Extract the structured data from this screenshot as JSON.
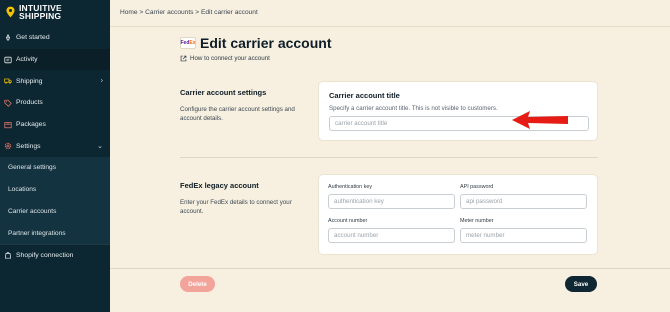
{
  "brand": {
    "line1": "INTUITIVE",
    "line2": "SHIPPING"
  },
  "sidebar": {
    "items": [
      {
        "label": "Get started",
        "icon": "rocket-icon"
      },
      {
        "label": "Activity",
        "icon": "activity-icon"
      },
      {
        "label": "Shipping",
        "icon": "truck-icon",
        "chevron": "›"
      },
      {
        "label": "Products",
        "icon": "tag-icon"
      },
      {
        "label": "Packages",
        "icon": "package-icon"
      },
      {
        "label": "Settings",
        "icon": "gear-icon",
        "chevron": "⌄"
      }
    ],
    "sub_items": [
      {
        "label": "General settings"
      },
      {
        "label": "Locations"
      },
      {
        "label": "Carrier accounts"
      },
      {
        "label": "Partner integrations"
      }
    ],
    "shopify": {
      "label": "Shopify connection",
      "icon": "shopify-icon"
    }
  },
  "breadcrumb": "Home > Carrier accounts > Edit carrier account",
  "page": {
    "title": "Edit carrier account",
    "logo_fe": "Fed",
    "logo_ex": "Ex",
    "help_link": "How to connect your account"
  },
  "carrier_settings": {
    "title": "Carrier account settings",
    "description": "Configure the carrier account settings and account details.",
    "card_title": "Carrier account title",
    "card_subtitle": "Specify a carrier account title. This is not visible to customers.",
    "title_placeholder": "carrier account title",
    "title_value": ""
  },
  "fedex_legacy": {
    "title": "FedEx legacy account",
    "description": "Enter your FedEx details to connect your account.",
    "fields": {
      "auth_key": {
        "label": "Authentication key",
        "placeholder": "authentication key"
      },
      "api_password": {
        "label": "API password",
        "placeholder": "api password"
      },
      "account_number": {
        "label": "Account number",
        "placeholder": "account number"
      },
      "meter_number": {
        "label": "Meter number",
        "placeholder": "meter number"
      }
    }
  },
  "buttons": {
    "delete": "Delete",
    "save": "Save"
  },
  "colors": {
    "sidebar_bg": "#0d2732",
    "page_bg": "#f7f0e1",
    "delete_bg": "#f2a39a",
    "save_bg": "#0f2732",
    "arrow": "#e51b14",
    "logo_pin": "#f2c200"
  }
}
